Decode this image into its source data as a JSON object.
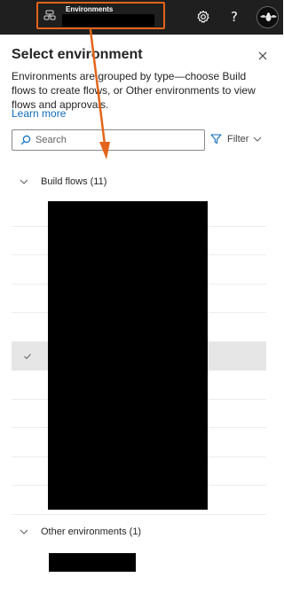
{
  "topbar": {
    "environment_label": "Environments",
    "icons": {
      "environment": "environment-icon",
      "settings": "gear-icon",
      "help": "help-icon",
      "avatar": "avatar"
    },
    "help_glyph": "?"
  },
  "panel": {
    "title": "Select environment",
    "description": "Environments are grouped by type—choose Build flows to create flows, or Other environments to view flows and approvals.",
    "learn_more": "Learn more",
    "search_placeholder": "Search",
    "filter_label": "Filter"
  },
  "groups": [
    {
      "label": "Build flows (11)",
      "expanded": true,
      "selected_row_index": 5
    },
    {
      "label": "Other environments (1)",
      "expanded": true
    }
  ],
  "colors": {
    "topbar": "#1f1f1f",
    "highlight": "#e3641b",
    "link": "#0f6cbd",
    "selected_row": "#e6e6e6"
  }
}
